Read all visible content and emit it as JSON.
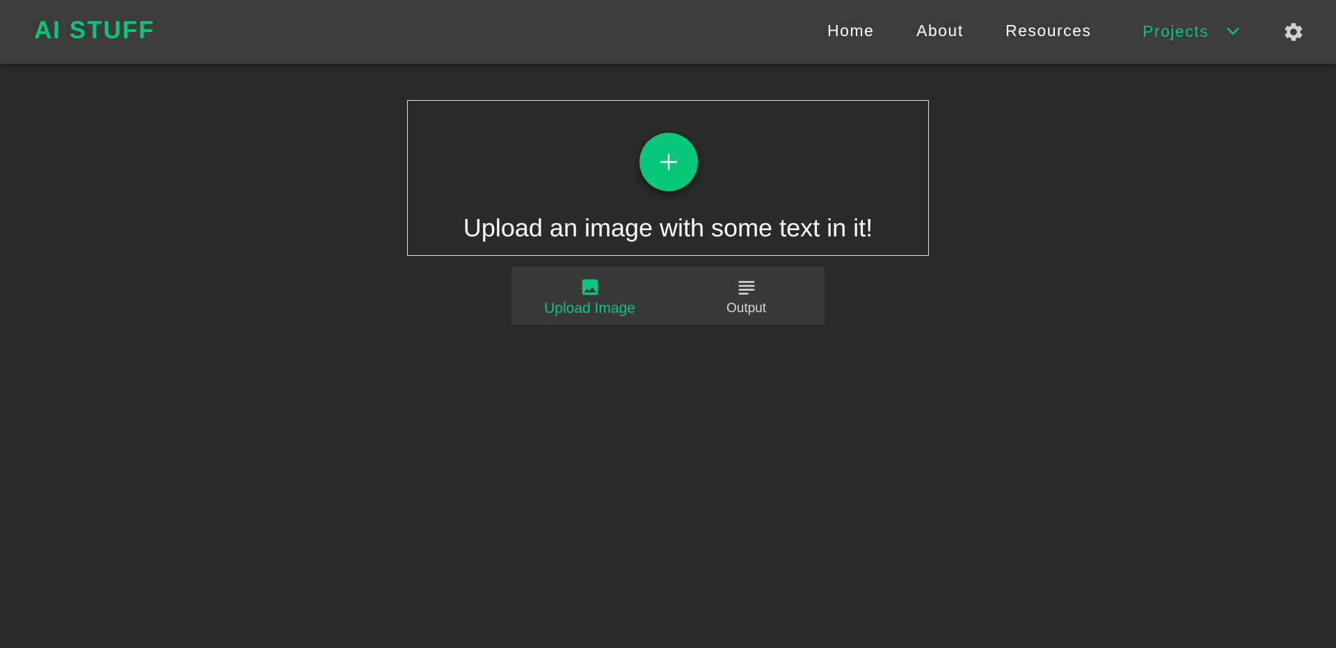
{
  "header": {
    "logo": "AI STUFF",
    "nav": {
      "home": "Home",
      "about": "About",
      "resources": "Resources",
      "projects": "Projects"
    },
    "icons": {
      "projects_dropdown": "chevron-down-icon",
      "settings": "gear-icon"
    }
  },
  "upload": {
    "button_icon": "plus-icon",
    "prompt": "Upload an image with some text in it!"
  },
  "tabs": [
    {
      "label": "Upload Image",
      "icon": "image-icon",
      "active": true
    },
    {
      "label": "Output",
      "icon": "text-lines-icon",
      "active": false
    }
  ],
  "colors": {
    "accent": "#08c77a",
    "background": "#2a2a2a",
    "header": "#3c3c3c",
    "tab_bar": "#393939",
    "text": "#ffffff"
  }
}
